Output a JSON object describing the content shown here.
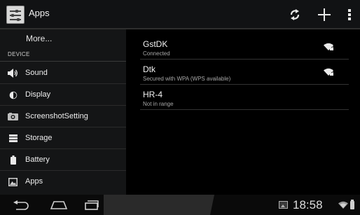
{
  "actionbar": {
    "title": "Apps",
    "icons": [
      "settings-sliders-icon",
      "refresh-scan-icon",
      "add-icon",
      "overflow-menu-icon"
    ]
  },
  "sidebar": {
    "more_label": "More...",
    "section_header": "DEVICE",
    "items": [
      {
        "label": "Sound",
        "icon": "speaker-icon"
      },
      {
        "label": "Display",
        "icon": "brightness-icon"
      },
      {
        "label": "ScreenshotSetting",
        "icon": "camera-icon"
      },
      {
        "label": "Storage",
        "icon": "storage-icon"
      },
      {
        "label": "Battery",
        "icon": "battery-icon"
      },
      {
        "label": "Apps",
        "icon": "apps-icon"
      }
    ]
  },
  "networks": [
    {
      "name": "GstDK",
      "status": "Connected",
      "signal": "wifi-locked-icon"
    },
    {
      "name": "Dtk",
      "status": "Secured with WPA (WPS available)",
      "signal": "wifi-locked-icon"
    },
    {
      "name": "HR-4",
      "status": "Not in range"
    }
  ],
  "systembar": {
    "clock": "18:58",
    "icons": [
      "back-icon",
      "home-icon",
      "recent-apps-icon",
      "screenshot-notification-icon",
      "wifi-status-icon",
      "battery-status-icon"
    ]
  }
}
